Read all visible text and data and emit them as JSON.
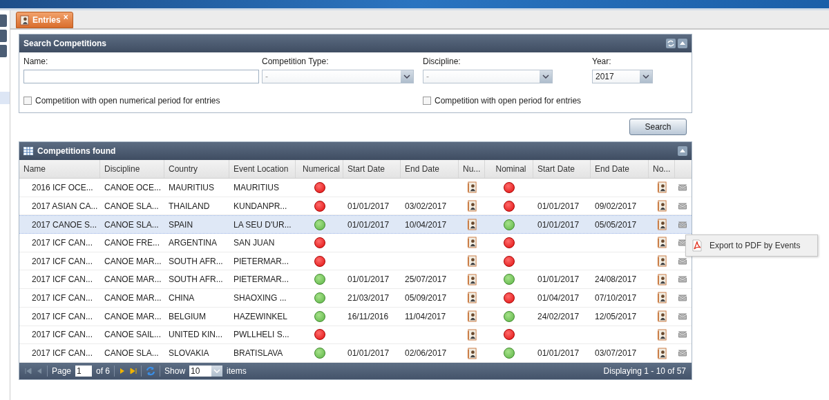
{
  "tab": {
    "label": "Entries",
    "close": "×",
    "selected": true
  },
  "search_panel": {
    "title": "Search Competitions",
    "name_field": {
      "label": "Name:"
    },
    "competition_type": {
      "label": "Competition Type:",
      "value": "-"
    },
    "discipline": {
      "label": "Discipline:",
      "value": "-"
    },
    "year": {
      "label": "Year:",
      "value": "2017"
    },
    "checkboxes": [
      {
        "label": "Competition with open numerical period for entries",
        "checked": false
      },
      {
        "label": "Competition with open period for entries",
        "checked": false
      }
    ],
    "button": "Search"
  },
  "grid": {
    "title": "Competitions found",
    "columns": [
      "Name",
      "Discipline",
      "Country",
      "Event Location",
      "Numerical",
      "Start Date",
      "End Date",
      "Nu...",
      "Nominal",
      "Start Date",
      "End Date",
      "No..."
    ],
    "rows": [
      {
        "name": "2016 ICF OCE...",
        "discipline": "CANOE OCE...",
        "country": "MAURITIUS",
        "location": "MAURITIUS",
        "numerical_open": false,
        "start": "",
        "end": "",
        "nominal_open": false,
        "nominal_start": "",
        "nominal_end": "",
        "selected": false
      },
      {
        "name": "2017 ASIAN CA...",
        "discipline": "CANOE SLA...",
        "country": "THAILAND",
        "location": "KUNDANPR...",
        "numerical_open": false,
        "start": "01/01/2017",
        "end": "03/02/2017",
        "nominal_open": false,
        "nominal_start": "01/01/2017",
        "nominal_end": "09/02/2017",
        "selected": false
      },
      {
        "name": "2017 CANOE S...",
        "discipline": "CANOE SLA...",
        "country": "SPAIN",
        "location": "LA SEU D'UR...",
        "numerical_open": true,
        "start": "01/01/2017",
        "end": "10/04/2017",
        "nominal_open": true,
        "nominal_start": "01/01/2017",
        "nominal_end": "05/05/2017",
        "selected": true
      },
      {
        "name": "2017 ICF CAN...",
        "discipline": "CANOE FRE...",
        "country": "ARGENTINA",
        "location": "SAN JUAN",
        "numerical_open": false,
        "start": "",
        "end": "",
        "nominal_open": false,
        "nominal_start": "",
        "nominal_end": "",
        "selected": false
      },
      {
        "name": "2017 ICF CAN...",
        "discipline": "CANOE MAR...",
        "country": "SOUTH AFR...",
        "location": "PIETERMAR...",
        "numerical_open": false,
        "start": "",
        "end": "",
        "nominal_open": false,
        "nominal_start": "",
        "nominal_end": "",
        "selected": false
      },
      {
        "name": "2017 ICF CAN...",
        "discipline": "CANOE MAR...",
        "country": "SOUTH AFR...",
        "location": "PIETERMAR...",
        "numerical_open": true,
        "start": "01/01/2017",
        "end": "25/07/2017",
        "nominal_open": true,
        "nominal_start": "01/01/2017",
        "nominal_end": "24/08/2017",
        "selected": false
      },
      {
        "name": "2017 ICF CAN...",
        "discipline": "CANOE MAR...",
        "country": "CHINA",
        "location": "SHAOXING ...",
        "numerical_open": true,
        "start": "21/03/2017",
        "end": "05/09/2017",
        "nominal_open": false,
        "nominal_start": "01/04/2017",
        "nominal_end": "07/10/2017",
        "selected": false
      },
      {
        "name": "2017 ICF CAN...",
        "discipline": "CANOE MAR...",
        "country": "BELGIUM",
        "location": "HAZEWINKEL",
        "numerical_open": true,
        "start": "16/11/2016",
        "end": "11/04/2017",
        "nominal_open": true,
        "nominal_start": "24/02/2017",
        "nominal_end": "12/05/2017",
        "selected": false
      },
      {
        "name": "2017 ICF CAN...",
        "discipline": "CANOE SAIL...",
        "country": "UNITED KIN...",
        "location": "PWLLHELI S...",
        "numerical_open": false,
        "start": "",
        "end": "",
        "nominal_open": false,
        "nominal_start": "",
        "nominal_end": "",
        "selected": false
      },
      {
        "name": "2017 ICF CAN...",
        "discipline": "CANOE SLA...",
        "country": "SLOVAKIA",
        "location": "BRATISLAVA",
        "numerical_open": true,
        "start": "01/01/2017",
        "end": "02/06/2017",
        "nominal_open": true,
        "nominal_start": "01/01/2017",
        "nominal_end": "03/07/2017",
        "selected": false
      }
    ],
    "paging": {
      "page_label": "Page",
      "page": "1",
      "of": "of 6",
      "show_label": "Show",
      "page_size": "10",
      "items_label": "items",
      "summary": "Displaying 1 - 10 of 57"
    }
  },
  "context_menu": {
    "items": [
      {
        "label": "Export to PDF by Events"
      }
    ]
  }
}
